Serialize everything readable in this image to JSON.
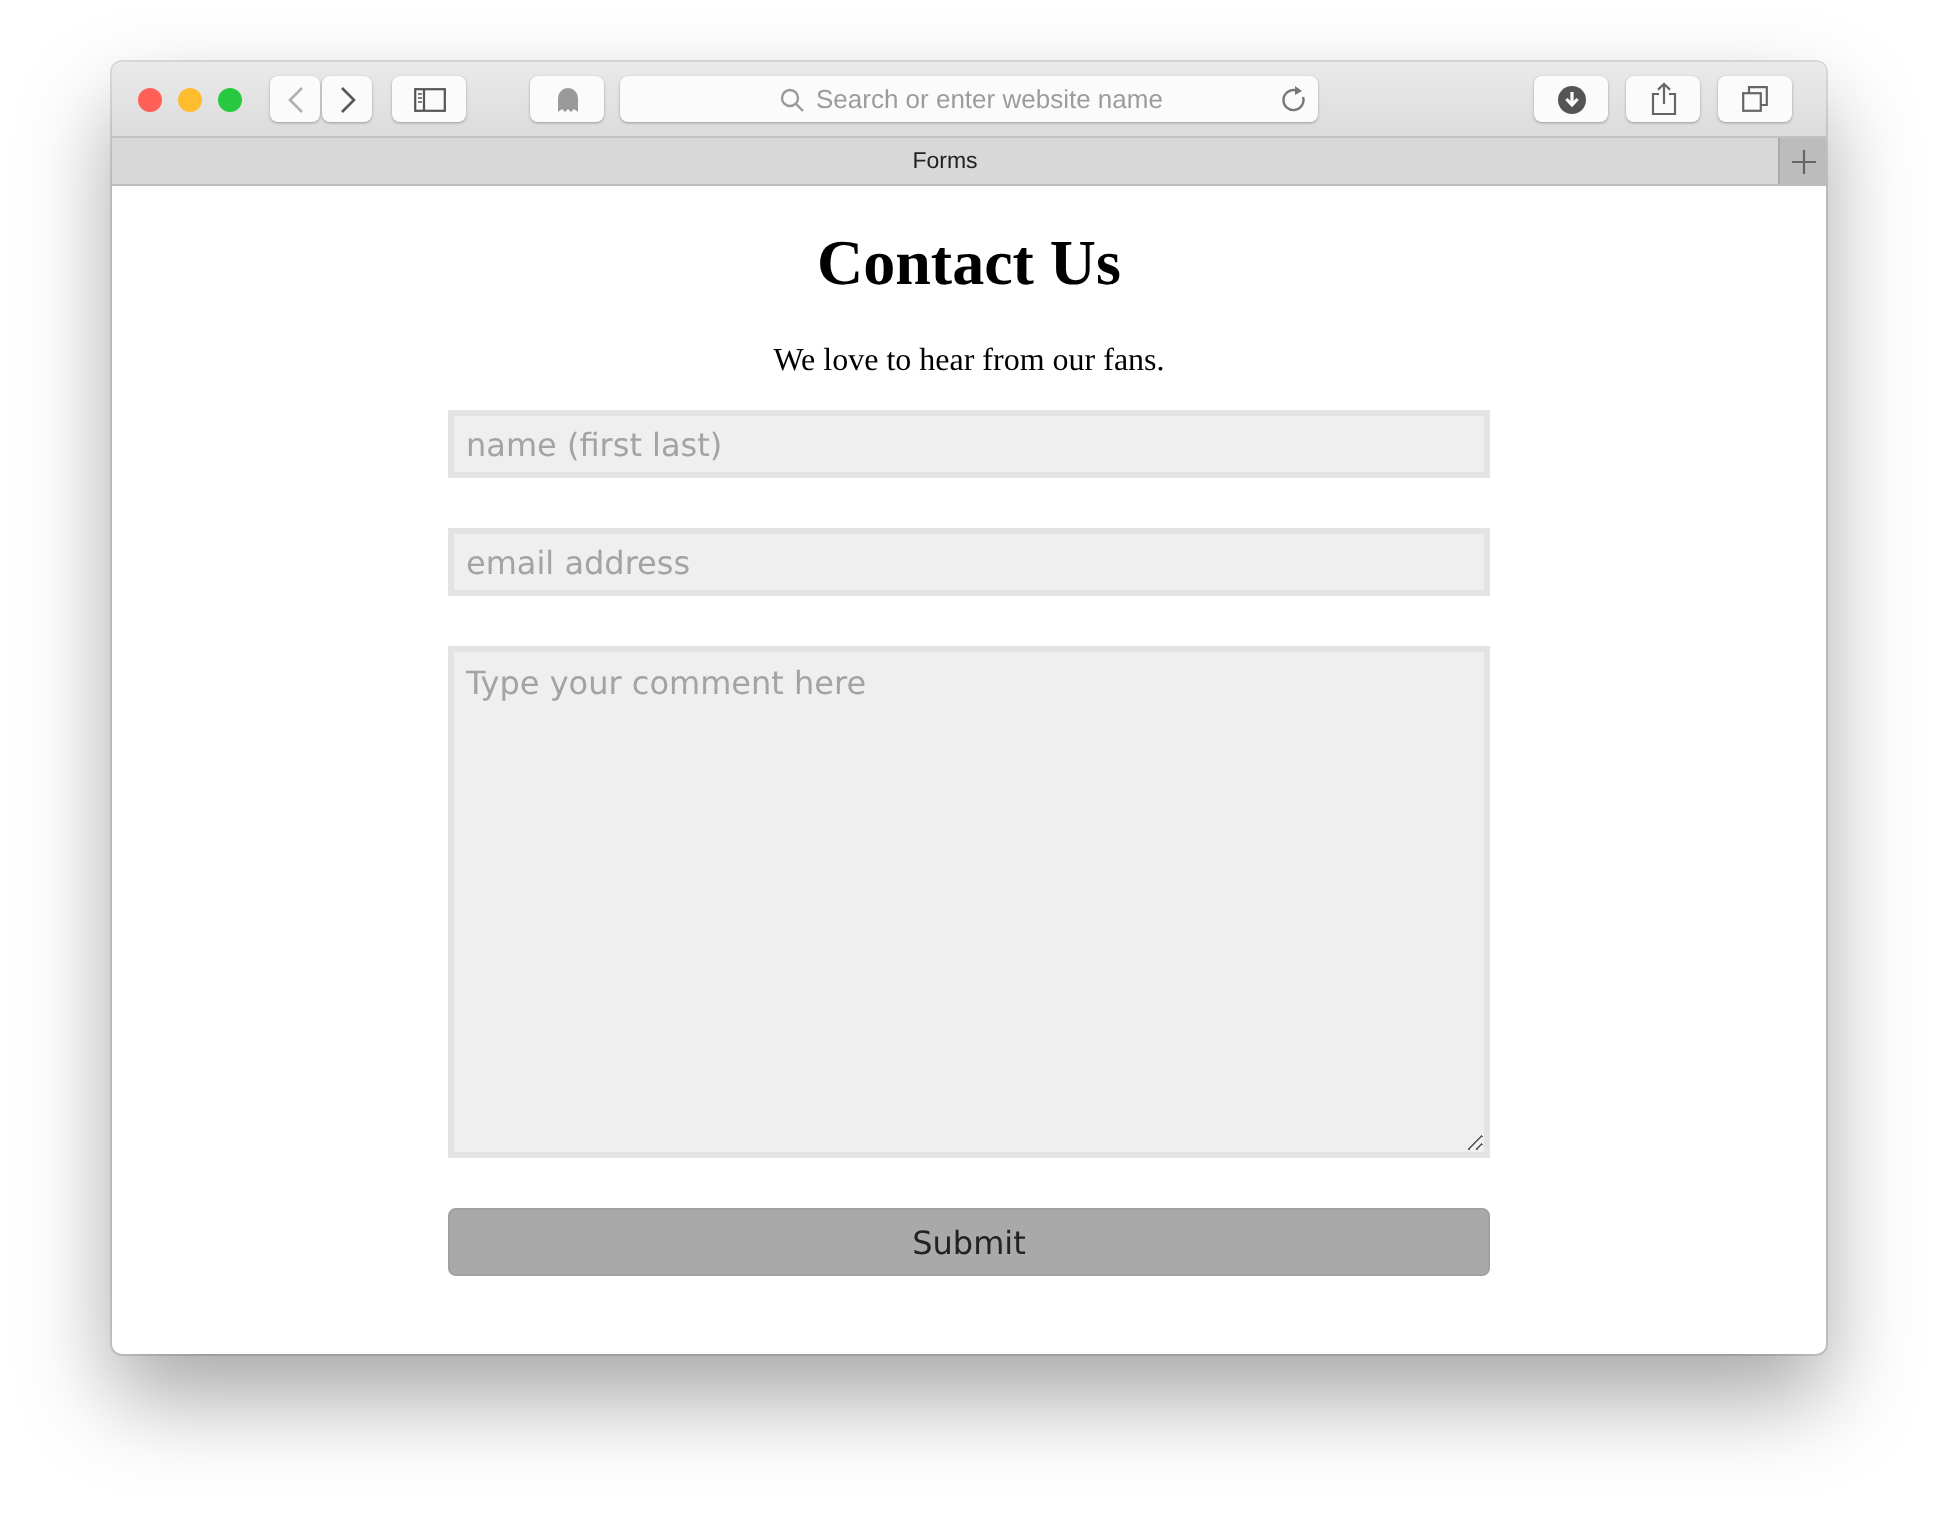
{
  "browser": {
    "address_placeholder": "Search or enter website name",
    "tab": {
      "title": "Forms",
      "selected": true
    }
  },
  "page": {
    "heading": "Contact Us",
    "subtitle": "We love to hear from our fans.",
    "fields": [
      {
        "kind": "input",
        "placeholder": "name (first last)"
      },
      {
        "kind": "input",
        "placeholder": "email address"
      },
      {
        "kind": "textarea",
        "placeholder": "Type your comment here"
      }
    ],
    "submit": "Submit"
  }
}
